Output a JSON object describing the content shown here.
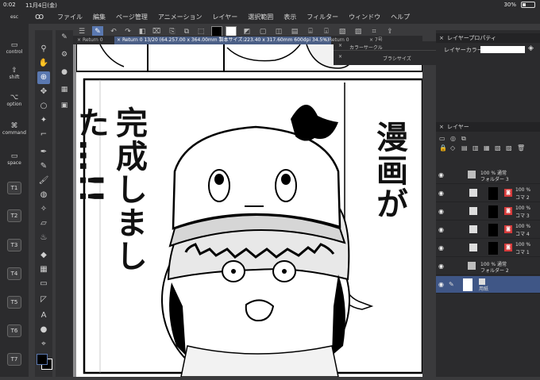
{
  "status": {
    "time": "0:02",
    "date": "11月4日(金)",
    "battery": "30%",
    "battery_level": 0.3
  },
  "menu": {
    "logo": "ꝏ",
    "items": [
      "ファイル",
      "編集",
      "ページ管理",
      "アニメーション",
      "レイヤー",
      "選択範囲",
      "表示",
      "フィルター",
      "ウィンドウ",
      "ヘルプ"
    ]
  },
  "left_shortcuts": [
    {
      "glyph": "",
      "label": "esc"
    },
    {
      "glyph": "",
      "label": "control"
    },
    {
      "glyph": "⇧",
      "label": "shift"
    },
    {
      "glyph": "⌥",
      "label": "option"
    },
    {
      "glyph": "⌘",
      "label": "command"
    },
    {
      "glyph": "▭",
      "label": "space"
    }
  ],
  "t_keys": [
    "T1",
    "T2",
    "T3",
    "T4",
    "T5",
    "T6",
    "T7"
  ],
  "tabs": [
    {
      "label": "Return 0",
      "active": false
    },
    {
      "label": "Return 0 13/20 (64.257.00 x 364.00mm 製本サイズ:223.40 x 317.60mm 600dpi 34.5%)",
      "active": true
    },
    {
      "label": "Return 0",
      "active": false
    },
    {
      "label": "7号",
      "active": false
    }
  ],
  "float_palette": {
    "color_circle": "カラーサークル",
    "brush_size": "ブラシサイズ"
  },
  "layer_property": {
    "title": "レイヤープロパティ",
    "layer_color_label": "レイヤーカラー"
  },
  "layers": {
    "title": "レイヤー",
    "rows": [
      {
        "kind": "folder",
        "l1": "100 % 通常",
        "l2": "フォルダー 3"
      },
      {
        "kind": "layer",
        "l1": "100 %",
        "l2": "コマ 2"
      },
      {
        "kind": "layer",
        "l1": "100 %",
        "l2": "コマ 3"
      },
      {
        "kind": "layer",
        "l1": "100 %",
        "l2": "コマ 4"
      },
      {
        "kind": "layer",
        "l1": "100 %",
        "l2": "コマ 1"
      },
      {
        "kind": "folder",
        "l1": "100 % 通常",
        "l2": "フォルダー 2"
      },
      {
        "kind": "paper",
        "l1": "",
        "l2": "用紙"
      }
    ]
  },
  "manga": {
    "caption": "完成しました…!!",
    "speech": "漫画が"
  },
  "colors": {
    "accent": "#5a78b0",
    "panel": "#2b2b2d",
    "selected_layer": "#3f5686",
    "mask_red": "#d63a3a"
  }
}
